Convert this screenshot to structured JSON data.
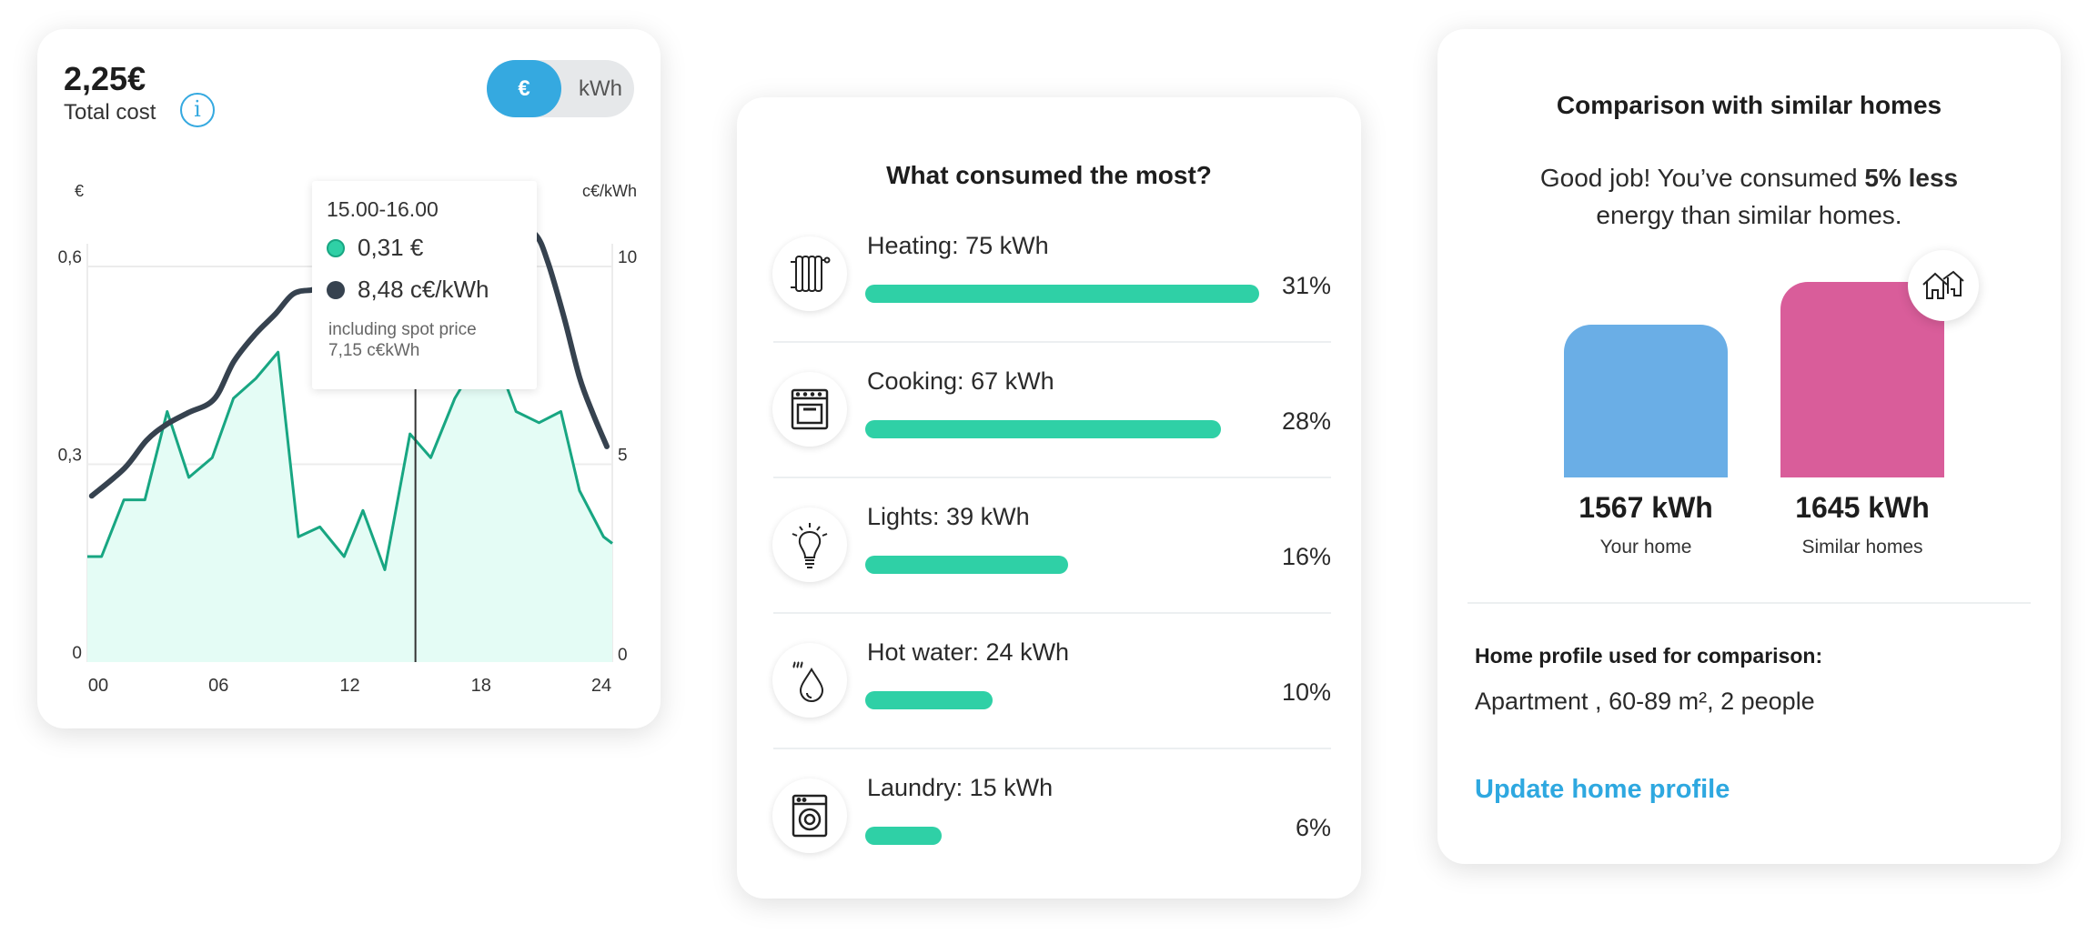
{
  "cost_card": {
    "total": "2,25€",
    "total_label": "Total cost",
    "info_icon": "info-icon",
    "toggle": {
      "eur": "€",
      "kwh": "kWh",
      "selected": "€"
    },
    "left_unit": "€",
    "right_unit": "c€/kWh",
    "tooltip": {
      "time": "15.00-16.00",
      "cost": "0,31 €",
      "price": "8,48 c€/kWh",
      "note": "including spot price",
      "spot": "7,15 c€kWh"
    }
  },
  "chart_data": {
    "type": "line",
    "x_ticks": [
      "00",
      "06",
      "12",
      "18",
      "24"
    ],
    "xlim": [
      0,
      24
    ],
    "y_left": {
      "unit": "€",
      "ticks": [
        "0",
        "0,3",
        "0,6"
      ],
      "range": [
        0,
        0.6
      ]
    },
    "y_right": {
      "unit": "c€/kWh",
      "ticks": [
        "0",
        "5",
        "10"
      ],
      "range": [
        0,
        10
      ]
    },
    "grid": true,
    "cursor_hour": 15,
    "series": [
      {
        "axis": "left",
        "style": "area",
        "color": "#18a682",
        "fill": "#e4fcf5",
        "x": [
          0,
          0.65,
          1.67,
          2.63,
          3.65,
          4.64,
          5.71,
          6.68,
          7.7,
          8.72,
          9.65,
          10.63,
          11.74,
          12.6,
          13.6,
          14.75,
          15.7,
          16.8,
          17.7,
          18.7,
          19.6,
          20.65,
          21.65,
          22.5,
          23.6,
          24
        ],
        "y": [
          0.16,
          0.16,
          0.246,
          0.246,
          0.38,
          0.28,
          0.31,
          0.4,
          0.43,
          0.47,
          0.19,
          0.205,
          0.16,
          0.23,
          0.14,
          0.346,
          0.31,
          0.4,
          0.45,
          0.46,
          0.38,
          0.363,
          0.38,
          0.26,
          0.19,
          0.18
        ]
      },
      {
        "axis": "right",
        "style": "smooth",
        "color": "#36424f",
        "x": [
          0.2,
          1.7,
          2.7,
          3.6,
          4.6,
          5.8,
          6.7,
          7.7,
          8.6,
          9.4,
          10.2,
          11,
          13,
          15,
          17,
          18.5,
          19.6,
          20.5,
          21.06,
          21.8,
          22.5,
          23.1,
          23.75
        ],
        "y": [
          4.2,
          4.9,
          5.6,
          6.0,
          6.3,
          6.65,
          7.6,
          8.3,
          8.8,
          9.3,
          9.4,
          9.4,
          9.0,
          8.48,
          9.6,
          10.6,
          11.0,
          10.8,
          10.1,
          8.7,
          7.2,
          6.3,
          5.45
        ]
      }
    ]
  },
  "consumption_card": {
    "title": "What consumed the most?",
    "items": [
      {
        "label": "Heating: 75 kWh",
        "percent": "31%",
        "fraction": 0.31,
        "icon": "radiator-icon"
      },
      {
        "label": "Cooking: 67 kWh",
        "percent": "28%",
        "fraction": 0.28,
        "icon": "oven-icon"
      },
      {
        "label": "Lights: 39 kWh",
        "percent": "16%",
        "fraction": 0.16,
        "icon": "lightbulb-icon"
      },
      {
        "label": "Hot water: 24 kWh",
        "percent": "10%",
        "fraction": 0.1,
        "icon": "water-drop-icon"
      },
      {
        "label": "Laundry: 15 kWh",
        "percent": "6%",
        "fraction": 0.06,
        "icon": "washing-machine-icon"
      }
    ],
    "bar_color": "#2fd0a6"
  },
  "comparison_card": {
    "title": "Comparison with similar homes",
    "message_pre": "Good job! You’ve consumed ",
    "message_bold": "5% less",
    "message_post": "energy than similar homes.",
    "bars": [
      {
        "value": 1567,
        "value_label": "1567 kWh",
        "label": "Your home",
        "color": "#6aaee6"
      },
      {
        "value": 1645,
        "value_label": "1645 kWh",
        "label": "Similar homes",
        "color": "#d95d9a"
      }
    ],
    "house_icon": "houses-icon",
    "profile_heading": "Home profile used for comparison:",
    "profile_value": "Apartment , 60-89 m², 2 people",
    "update_link": "Update home profile",
    "link_color": "#2ea8e0"
  }
}
